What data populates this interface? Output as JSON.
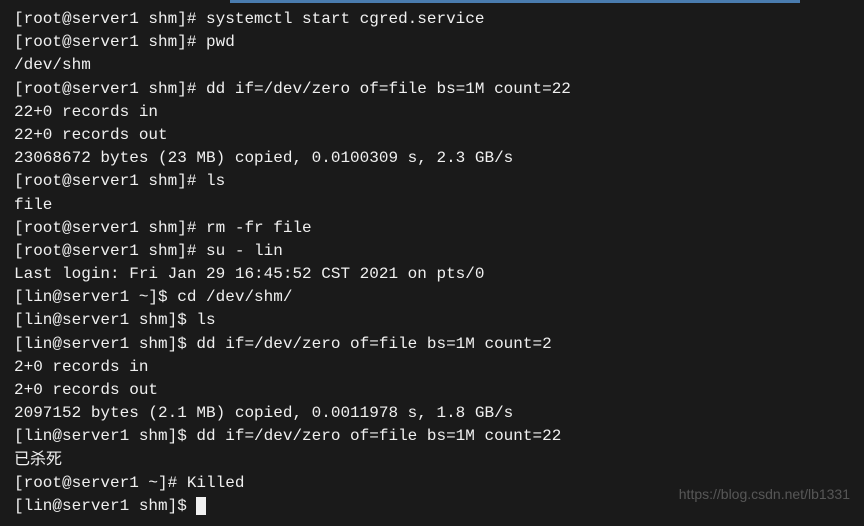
{
  "lines": {
    "l0": "[root@server1 shm]# systemctl start cgred.service",
    "l1": "[root@server1 shm]# pwd",
    "l2": "/dev/shm",
    "l3": "[root@server1 shm]# dd if=/dev/zero of=file bs=1M count=22",
    "l4": "22+0 records in",
    "l5": "22+0 records out",
    "l6": "23068672 bytes (23 MB) copied, 0.0100309 s, 2.3 GB/s",
    "l7": "[root@server1 shm]# ls",
    "l8": "file",
    "l9": "[root@server1 shm]# rm -fr file",
    "l10": "[root@server1 shm]# su - lin",
    "l11": "Last login: Fri Jan 29 16:45:52 CST 2021 on pts/0",
    "l12": "[lin@server1 ~]$ cd /dev/shm/",
    "l13": "[lin@server1 shm]$ ls",
    "l14": "[lin@server1 shm]$ dd if=/dev/zero of=file bs=1M count=2",
    "l15": "2+0 records in",
    "l16": "2+0 records out",
    "l17": "2097152 bytes (2.1 MB) copied, 0.0011978 s, 1.8 GB/s",
    "l18": "[lin@server1 shm]$ dd if=/dev/zero of=file bs=1M count=22",
    "l19": "已杀死",
    "l20": "[root@server1 ~]# Killed",
    "l21": "[lin@server1 shm]$ "
  },
  "watermark": "https://blog.csdn.net/lb1331"
}
